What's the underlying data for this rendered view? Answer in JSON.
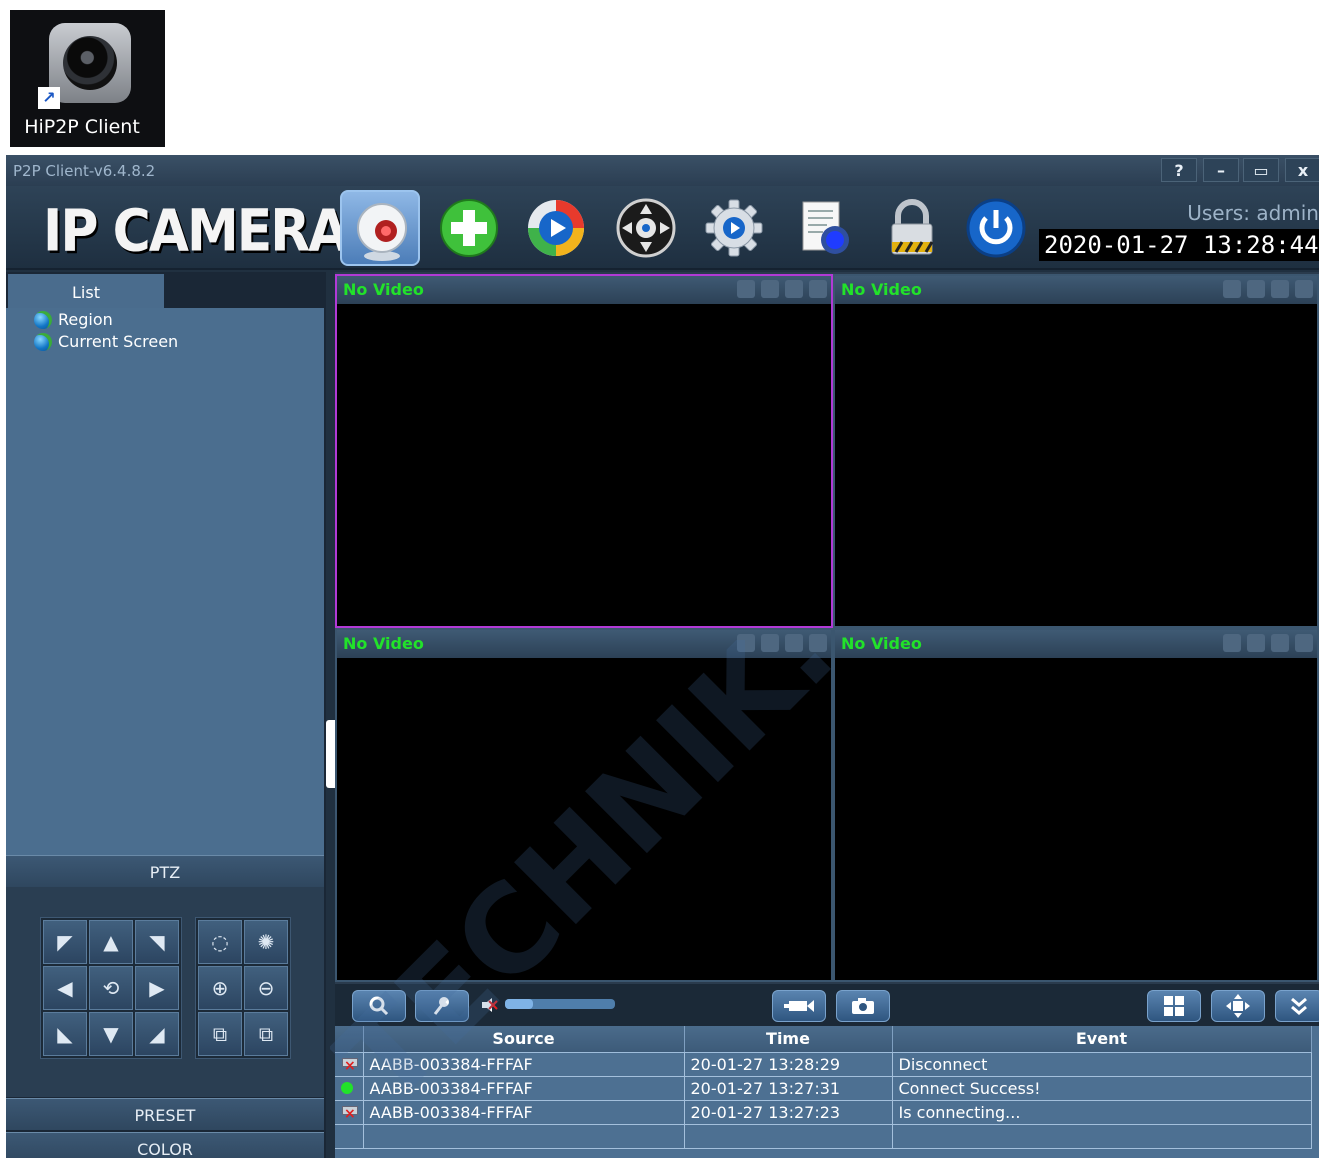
{
  "desktop": {
    "icon_label": "HiP2P Client"
  },
  "window": {
    "title": "P2P Client-v6.4.8.2",
    "controls": {
      "help": "?",
      "minimize": "–",
      "maximize": "▭",
      "close": "x"
    }
  },
  "toolbar": {
    "logo": "IP CAMERA",
    "users_label": "Users: admin",
    "clock": "2020-01-27 13:28:44",
    "buttons": [
      "monitor-icon",
      "add-device-icon",
      "playback-icon",
      "ptz-control-icon",
      "settings-icon",
      "log-icon",
      "lock-icon",
      "power-icon"
    ]
  },
  "left": {
    "list_tab": "List",
    "tree": [
      "Region",
      "Current Screen"
    ],
    "ptz_header": "PTZ",
    "preset_header": "PRESET",
    "color_header": "COLOR"
  },
  "video": {
    "panes": [
      {
        "label": "No Video",
        "selected": true
      },
      {
        "label": "No Video",
        "selected": false
      },
      {
        "label": "No Video",
        "selected": false
      },
      {
        "label": "No Video",
        "selected": false
      }
    ]
  },
  "controls": {
    "volume_level": 0.25
  },
  "events": {
    "columns": [
      "",
      "Source",
      "Time",
      "Event"
    ],
    "rows": [
      {
        "status": "disconnected",
        "source": "AABB-003384-FFFAF",
        "time": "20-01-27 13:28:29",
        "event": "Disconnect"
      },
      {
        "status": "connected",
        "source": "AABB-003384-FFFAF",
        "time": "20-01-27 13:27:31",
        "event": "Connect Success!"
      },
      {
        "status": "disconnected",
        "source": "AABB-003384-FFFAF",
        "time": "20-01-27 13:27:23",
        "event": "Is connecting..."
      }
    ]
  },
  "watermark": "TECHNIK.CZ"
}
